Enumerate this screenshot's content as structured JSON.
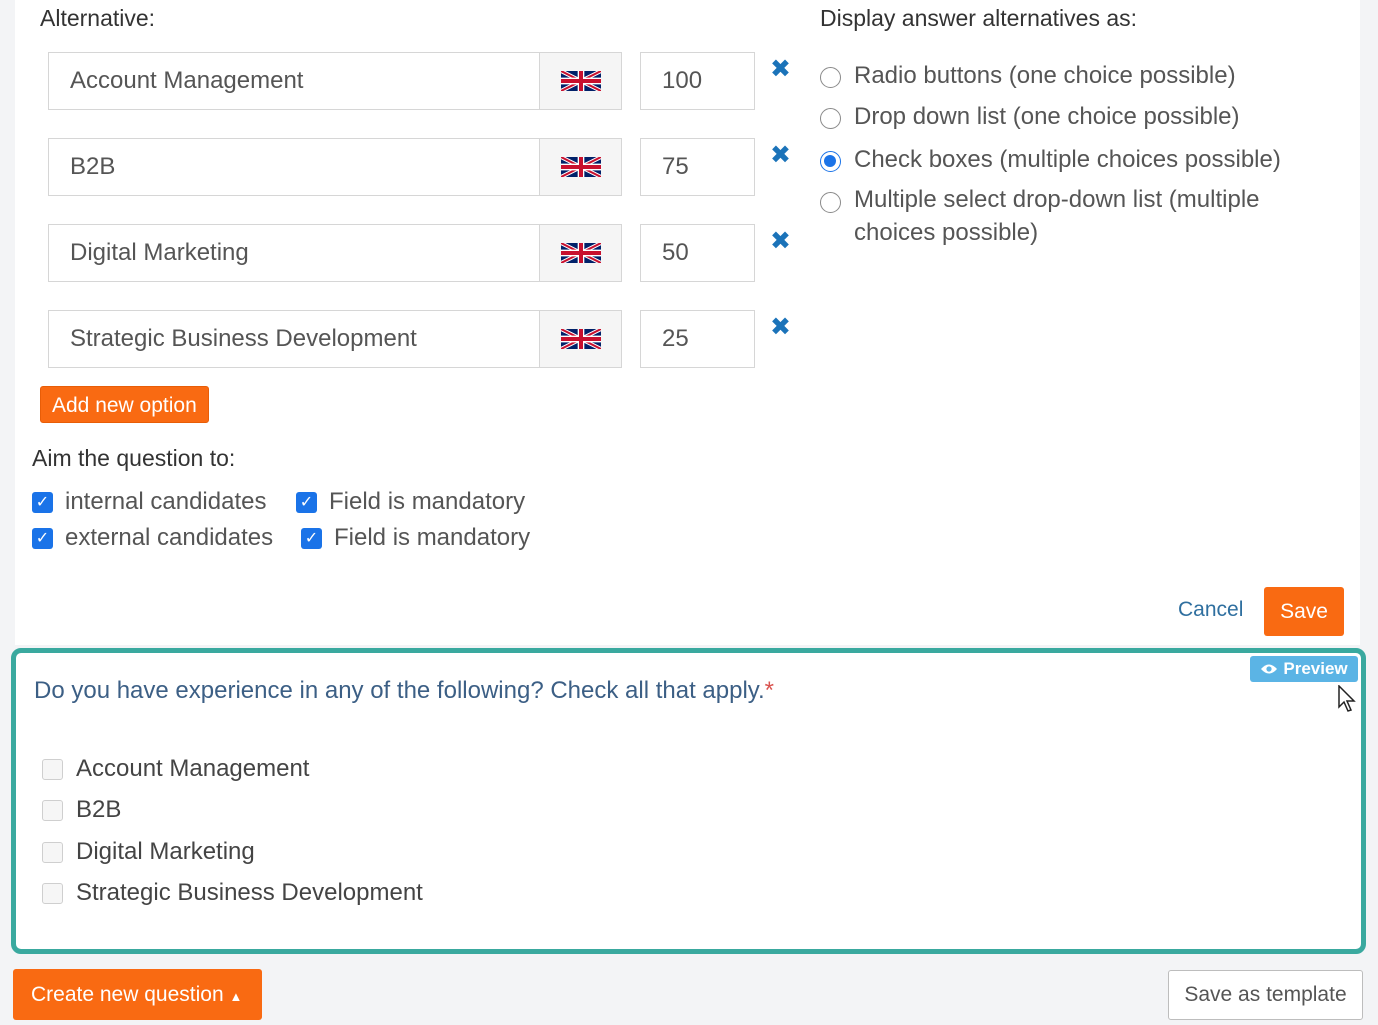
{
  "alternatives": {
    "title": "Alternative:",
    "items": [
      {
        "text": "Account Management",
        "score": "100"
      },
      {
        "text": "B2B",
        "score": "75"
      },
      {
        "text": "Digital Marketing",
        "score": "50"
      },
      {
        "text": "Strategic Business Development",
        "score": "25"
      }
    ],
    "language_icon": "uk-flag-icon",
    "remove_icon": "close-icon",
    "add_label": "Add new option"
  },
  "display": {
    "title": "Display answer alternatives as:",
    "options": [
      {
        "label": "Radio buttons (one choice possible)",
        "selected": false
      },
      {
        "label": "Drop down list (one choice possible)",
        "selected": false
      },
      {
        "label": "Check boxes (multiple choices possible)",
        "selected": true
      },
      {
        "label": "Multiple select drop-down list (multiple choices possible)",
        "selected": false
      }
    ]
  },
  "aim": {
    "title": "Aim the question to:",
    "rows": [
      {
        "audience": "internal candidates",
        "mandatory": "Field is mandatory"
      },
      {
        "audience": "external candidates",
        "mandatory": "Field is mandatory"
      }
    ]
  },
  "actions": {
    "cancel": "Cancel",
    "save": "Save"
  },
  "preview": {
    "badge": "Preview",
    "badge_icon": "eye-icon",
    "question": "Do you have experience in any of the following? Check all that apply.",
    "required_mark": "*",
    "options": [
      "Account Management",
      "B2B",
      "Digital Marketing",
      "Strategic Business Development"
    ]
  },
  "footer": {
    "create_label": "Create new question",
    "create_icon": "caret-up-icon",
    "template_label": "Save as template"
  },
  "colors": {
    "accent": "#f96a12",
    "link": "#1b73b9",
    "preview_border": "#3aa99f"
  }
}
